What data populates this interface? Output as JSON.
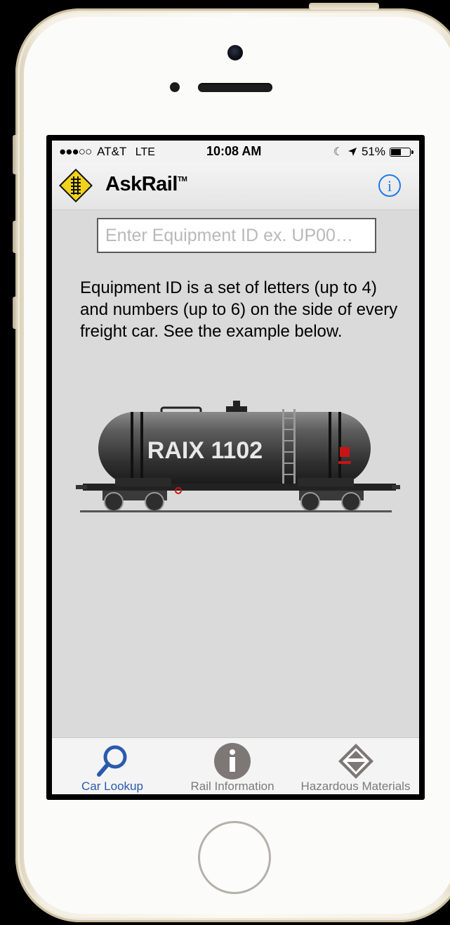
{
  "status_bar": {
    "signal": "●●●○○",
    "carrier": "AT&T",
    "network": "LTE",
    "time": "10:08 AM",
    "battery": "51%",
    "battery_level": 0.51
  },
  "nav": {
    "brand": "AskRail",
    "trademark": "TM"
  },
  "search": {
    "placeholder": "Enter Equipment ID ex. UP00…",
    "value": ""
  },
  "description": "Equipment ID is a set of letters (up to 4) and numbers (up to 6) on the side of every freight car. See the example below.",
  "example_car": {
    "marking": "RAIX 1102"
  },
  "tabs": [
    {
      "label": "Car Lookup",
      "icon": "magnifier-icon",
      "active": true
    },
    {
      "label": "Rail Information",
      "icon": "info-icon",
      "active": false
    },
    {
      "label": "Hazardous Materials",
      "icon": "hazmat-diamond-icon",
      "active": false
    }
  ],
  "colors": {
    "accent": "#1e7ae8",
    "tab_active": "#2a5ab0",
    "logo_yellow": "#f2d21b"
  }
}
